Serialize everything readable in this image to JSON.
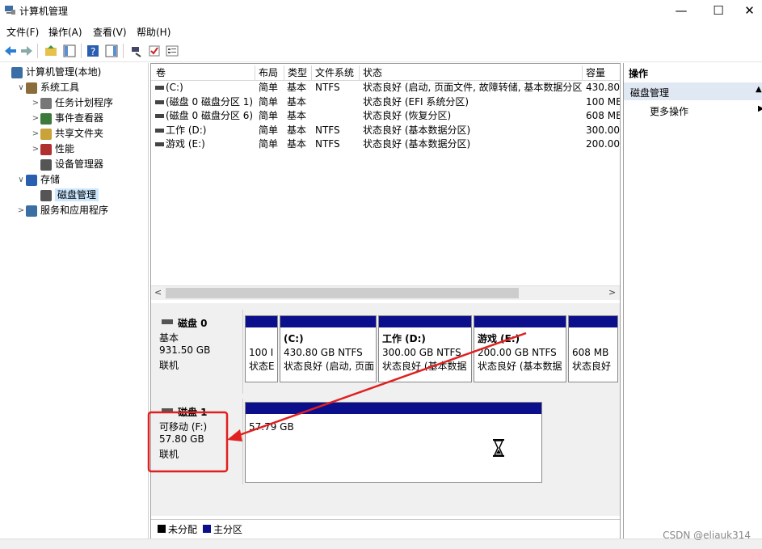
{
  "window": {
    "title": "计算机管理",
    "minimize": "—",
    "maximize": "☐",
    "close": "✕"
  },
  "menu": [
    "文件(F)",
    "操作(A)",
    "查看(V)",
    "帮助(H)"
  ],
  "tree": [
    {
      "label": "计算机管理(本地)",
      "icon": "computer-management-icon",
      "indent": 0,
      "chevron": ""
    },
    {
      "label": "系统工具",
      "icon": "tools-icon",
      "indent": 1,
      "chevron": "∨"
    },
    {
      "label": "任务计划程序",
      "icon": "clock-icon",
      "indent": 2,
      "chevron": ">"
    },
    {
      "label": "事件查看器",
      "icon": "event-viewer-icon",
      "indent": 2,
      "chevron": ">"
    },
    {
      "label": "共享文件夹",
      "icon": "shared-folder-icon",
      "indent": 2,
      "chevron": ">"
    },
    {
      "label": "性能",
      "icon": "performance-icon",
      "indent": 2,
      "chevron": ">"
    },
    {
      "label": "设备管理器",
      "icon": "device-manager-icon",
      "indent": 2,
      "chevron": ""
    },
    {
      "label": "存储",
      "icon": "storage-icon",
      "indent": 1,
      "chevron": "∨"
    },
    {
      "label": "磁盘管理",
      "icon": "disk-management-icon",
      "indent": 2,
      "chevron": "",
      "selected": true
    },
    {
      "label": "服务和应用程序",
      "icon": "services-icon",
      "indent": 1,
      "chevron": ">"
    }
  ],
  "volume_table": {
    "columns": [
      "卷",
      "布局",
      "类型",
      "文件系统",
      "状态",
      "容量"
    ],
    "rows": [
      [
        "(C:)",
        "简单",
        "基本",
        "NTFS",
        "状态良好 (启动, 页面文件, 故障转储, 基本数据分区)",
        "430.80"
      ],
      [
        "(磁盘 0 磁盘分区 1)",
        "简单",
        "基本",
        "",
        "状态良好 (EFI 系统分区)",
        "100 ME"
      ],
      [
        "(磁盘 0 磁盘分区 6)",
        "简单",
        "基本",
        "",
        "状态良好 (恢复分区)",
        "608 ME"
      ],
      [
        "工作 (D:)",
        "简单",
        "基本",
        "NTFS",
        "状态良好 (基本数据分区)",
        "300.00"
      ],
      [
        "游戏 (E:)",
        "简单",
        "基本",
        "NTFS",
        "状态良好 (基本数据分区)",
        "200.00"
      ]
    ]
  },
  "disks": [
    {
      "name": "磁盘 0",
      "type": "基本",
      "size": "931.50 GB",
      "status": "联机",
      "partitions": [
        {
          "title": "",
          "line1": "100 I",
          "line2": "状态E"
        },
        {
          "title": "(C:)",
          "line1": "430.80 GB NTFS",
          "line2": "状态良好 (启动, 页面"
        },
        {
          "title": "工作 (D:)",
          "line1": "300.00 GB NTFS",
          "line2": "状态良好 (基本数据"
        },
        {
          "title": "游戏 (E:)",
          "line1": "200.00 GB NTFS",
          "line2": "状态良好 (基本数据"
        },
        {
          "title": "",
          "line1": "608 MB",
          "line2": "状态良好"
        }
      ]
    },
    {
      "name": "磁盘 1",
      "type": "可移动 (F:)",
      "size": "57.80 GB",
      "status": "联机",
      "partitions": [
        {
          "title": "",
          "line1": "57.79 GB",
          "line2": ""
        }
      ]
    }
  ],
  "legend": [
    {
      "label": "未分配",
      "color": "#000000"
    },
    {
      "label": "主分区",
      "color": "#0c0f8c"
    }
  ],
  "actions": {
    "header": "操作",
    "section": "磁盘管理",
    "more": "更多操作"
  },
  "watermark": "CSDN @eliauk314",
  "colors": {
    "accent": "#0c0f8c",
    "annotation": "#e02020",
    "selected_bg": "#cce8ff",
    "section_bg": "#dfe8f3"
  }
}
